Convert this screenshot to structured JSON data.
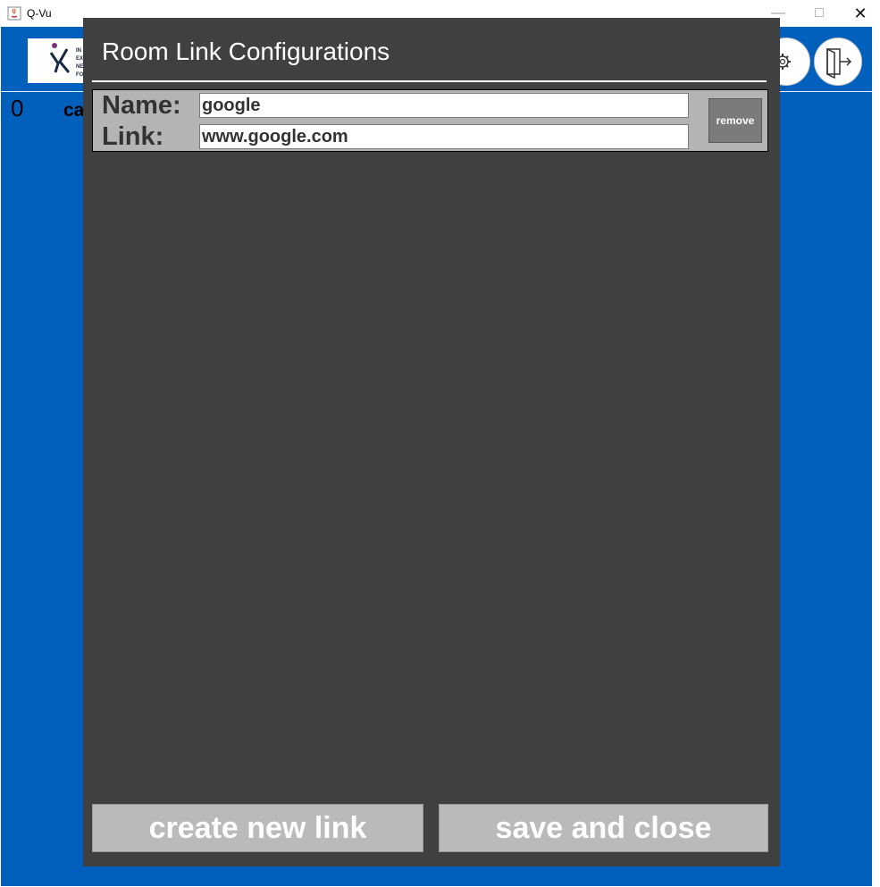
{
  "window": {
    "title": "Q-Vu",
    "minimize_glyph": "—",
    "maximize_glyph": "□",
    "close_glyph": "✕"
  },
  "background": {
    "count": "0",
    "partial_label": "ca",
    "logo_text": [
      "IN",
      "EX",
      "NE",
      "FO"
    ]
  },
  "dialog": {
    "title": "Room Link Configurations",
    "links": [
      {
        "name_label": "Name:",
        "name_value": "google",
        "link_label": "Link:",
        "link_value": "www.google.com",
        "remove_label": "remove"
      }
    ],
    "create_button": "create new link",
    "save_button": "save and close"
  },
  "colors": {
    "app_background": "#0060bb",
    "dialog_background": "#404040",
    "panel_background": "#b4b4b4",
    "button_background": "#bababa"
  },
  "icons": [
    "java-app-icon",
    "gear-icon",
    "exit-door-icon",
    "logo-icon"
  ]
}
